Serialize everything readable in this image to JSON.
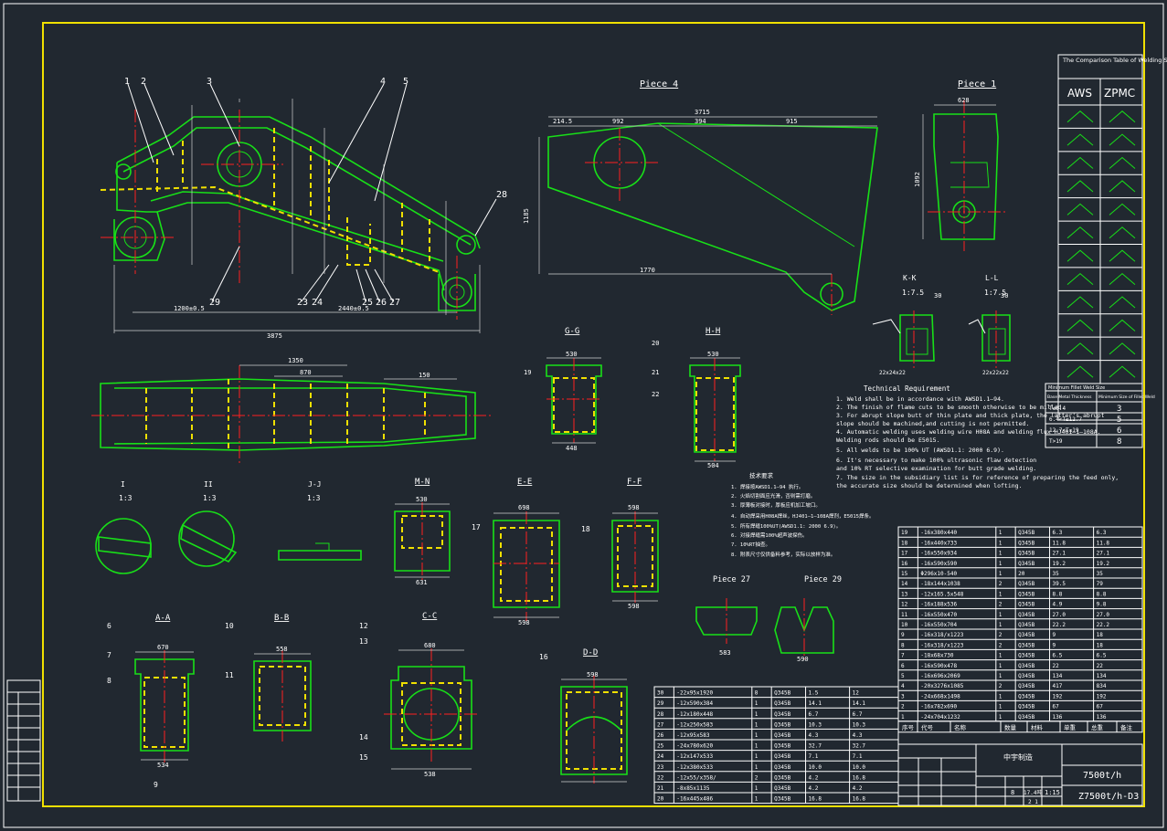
{
  "title_block": {
    "company": "中宇制造",
    "product_title": "7500t/h",
    "drawing_number": "Z7500t/h-D3",
    "scale": "1:15",
    "sheet_numbers": [
      "8",
      "17.4吨"
    ],
    "sheet_of": "2 1"
  },
  "comparison_table": {
    "title": "The Comparison Table of Welding Symbols",
    "col_aws": "AWS",
    "col_zpmc": "ZPMC",
    "min_weld_title": "Minimum Fillet Weld Size",
    "min_weld_header_a": "Base Metal Thickness",
    "min_weld_header_b": "Minimum Size of Fillet Weld",
    "min_weld_rows": [
      {
        "range": "T≤6.4",
        "size": "3"
      },
      {
        "range": "6.4<T≤12.7",
        "size": "5"
      },
      {
        "range": "12.7<T≤19",
        "size": "6"
      },
      {
        "range": "T>19",
        "size": "8"
      }
    ]
  },
  "technical_requirement": {
    "title": "Technical Requirement",
    "lines": [
      "1. Weld shall be in accordance with AWSD1.1—94.",
      "2. The finish of flame cuts to be smooth otherwise to be milled.",
      "3. For abrupt slope butt of thin plate and thick plate, the latter's abrupt",
      "   slope should be machined,and cutting is not permitted.",
      "4. Automatic welding uses welding wire H08A and welding flux HJ401—1—108A.",
      "   Welding rods should be E5015.",
      "5. All welds to be 100% UT (AWSD1.1: 2000 6.9).",
      "6. It's necessary to make 100% ultrasonic flaw detection",
      "   and 10% RT selective examination for butt grade welding.",
      "7. The size in the subsidiary list is for reference of preparing the feed only,",
      "   the accurate size should be determined when lofting."
    ],
    "cn_title": "技术要求",
    "cn_lines": [
      "1. 焊接按AWSD1.1—94 执行。",
      "2. 火焰切割面应光滑，否则需打磨。",
      "3. 厚薄板对接时，厚板应机加工坡口。",
      "4. 自动焊采用H08A焊丝，HJ401—1—108A焊剂，E5015焊条。",
      "5. 所有焊缝100%UT(AWSD1.1: 2000 6.9)。",
      "6. 对接焊缝需100%超声波探伤。",
      "7. 10%RT抽查。",
      "8. 附表尺寸仅供备料参考，实际以放样为准。"
    ]
  },
  "views": {
    "piece4": "Piece 4",
    "piece1": "Piece 1",
    "piece27": "Piece 27",
    "piece29": "Piece 29",
    "kk": "K-K",
    "ll": "L-L",
    "kk_scale": "1:7.5",
    "ll_scale": "1:7.5",
    "gg": "G-G",
    "hh": "H-H",
    "i": "I",
    "ii": "II",
    "jj": "J-J",
    "mn": "M-N",
    "ee": "E-E",
    "ff": "F-F",
    "aa": "A-A",
    "bb": "B-B",
    "cc": "C-C",
    "dd": "D-D",
    "detail_scale": "1:3"
  },
  "dims": {
    "overall": "3875",
    "main_b": "1200±0.5",
    "main_c": "2440±0.5",
    "piece4_len": "3715",
    "piece4_a": "214.5",
    "piece4_b": "992",
    "piece4_c": "394",
    "piece4_d": "915",
    "piece4_e": "1770",
    "piece4_f": "1185",
    "piece1_w": "628",
    "piece1_h": "1092",
    "plan_top": "1350",
    "plan_mid": "870",
    "plan_side": "150",
    "aa_w": "670",
    "aa_b": "534",
    "bb_w": "558",
    "cc_w": "680",
    "cc_b": "538",
    "dd_w": "598",
    "gg_w": "530",
    "gg_b": "448",
    "hh_w": "530",
    "hh_b": "504",
    "mn_w": "530",
    "mn_b": "631",
    "ee_w": "698",
    "ee_b": "598",
    "ff_w": "598",
    "ff_b": "598",
    "p27_w": "583",
    "p29_w": "590",
    "kk_weld": "22x24x22",
    "ll_weld": "22x22x22"
  },
  "callouts": [
    "1",
    "2",
    "3",
    "4",
    "5",
    "6",
    "7",
    "8",
    "9",
    "10",
    "11",
    "12",
    "13",
    "14",
    "15",
    "16",
    "17",
    "18",
    "19",
    "20",
    "21",
    "22",
    "23",
    "24",
    "25",
    "26",
    "27",
    "28",
    "29",
    "30"
  ],
  "parts_list_header": [
    "序号",
    "代号",
    "名称",
    "数量",
    "材料",
    "单重",
    "总重",
    "备注"
  ],
  "parts_list_right": [
    {
      "no": "19",
      "name": "-16x380x440",
      "qty": "1",
      "mat": "Q345B",
      "w1": "6.3",
      "w2": "6.3"
    },
    {
      "no": "18",
      "name": "-16x440x733",
      "qty": "1",
      "mat": "Q345B",
      "w1": "11.8",
      "w2": "11.8"
    },
    {
      "no": "17",
      "name": "-16x550x934",
      "qty": "1",
      "mat": "Q345B",
      "w1": "27.1",
      "w2": "27.1"
    },
    {
      "no": "16",
      "name": "-16x590x590",
      "qty": "1",
      "mat": "Q345B",
      "w1": "19.2",
      "w2": "19.2"
    },
    {
      "no": "15",
      "name": "Φ296x10-540",
      "qty": "1",
      "mat": "20",
      "w1": "35",
      "w2": "35"
    },
    {
      "no": "14",
      "name": "-18x144x1038",
      "qty": "2",
      "mat": "Q345B",
      "w1": "39.5",
      "w2": "79"
    },
    {
      "no": "13",
      "name": "-12x165.5x548",
      "qty": "1",
      "mat": "Q345B",
      "w1": "8.8",
      "w2": "8.8"
    },
    {
      "no": "12",
      "name": "-16x188x536",
      "qty": "2",
      "mat": "Q345B",
      "w1": "4.9",
      "w2": "9.8"
    },
    {
      "no": "11",
      "name": "-16x550x470",
      "qty": "1",
      "mat": "Q345B",
      "w1": "27.0",
      "w2": "27.0"
    },
    {
      "no": "10",
      "name": "-16x550x704",
      "qty": "1",
      "mat": "Q345B",
      "w1": "22.2",
      "w2": "22.2"
    },
    {
      "no": "9",
      "name": "-16x318/x1223",
      "qty": "2",
      "mat": "Q345B",
      "w1": "9",
      "w2": "18"
    },
    {
      "no": "8",
      "name": "-16x318/x1223",
      "qty": "2",
      "mat": "Q345B",
      "w1": "9",
      "w2": "18"
    },
    {
      "no": "7",
      "name": "-18x68x730",
      "qty": "1",
      "mat": "Q345B",
      "w1": "6.5",
      "w2": "6.5"
    },
    {
      "no": "6",
      "name": "-16x590x478",
      "qty": "1",
      "mat": "Q345B",
      "w1": "22",
      "w2": "22"
    },
    {
      "no": "5",
      "name": "-16x696x2069",
      "qty": "1",
      "mat": "Q345B",
      "w1": "134",
      "w2": "134"
    },
    {
      "no": "4",
      "name": "-20x3276x1085",
      "qty": "2",
      "mat": "Q345B",
      "w1": "417",
      "w2": "834"
    },
    {
      "no": "3",
      "name": "-24x668x1498",
      "qty": "1",
      "mat": "Q345B",
      "w1": "192",
      "w2": "192"
    },
    {
      "no": "2",
      "name": "-16x782x690",
      "qty": "1",
      "mat": "Q345B",
      "w1": "67",
      "w2": "67"
    },
    {
      "no": "1",
      "name": "-24x704x1232",
      "qty": "1",
      "mat": "Q345B",
      "w1": "136",
      "w2": "136"
    }
  ],
  "parts_list_left": [
    {
      "no": "30",
      "name": "-22x95x1920",
      "qty": "8",
      "mat": "Q345B",
      "w1": "1.5",
      "w2": "12"
    },
    {
      "no": "29",
      "name": "-12x590x384",
      "qty": "1",
      "mat": "Q345B",
      "w1": "14.1",
      "w2": "14.1"
    },
    {
      "no": "28",
      "name": "-12x180x448",
      "qty": "1",
      "mat": "Q345B",
      "w1": "6.7",
      "w2": "6.7"
    },
    {
      "no": "27",
      "name": "-12x250x583",
      "qty": "1",
      "mat": "Q345B",
      "w1": "10.3",
      "w2": "10.3"
    },
    {
      "no": "26",
      "name": "-12x95x583",
      "qty": "1",
      "mat": "Q345B",
      "w1": "4.3",
      "w2": "4.3"
    },
    {
      "no": "25",
      "name": "-24x780x620",
      "qty": "1",
      "mat": "Q345B",
      "w1": "32.7",
      "w2": "32.7"
    },
    {
      "no": "24",
      "name": "-12x147x533",
      "qty": "1",
      "mat": "Q345B",
      "w1": "7.1",
      "w2": "7.1"
    },
    {
      "no": "23",
      "name": "-12x380x533",
      "qty": "1",
      "mat": "Q345B",
      "w1": "10.0",
      "w2": "10.0"
    },
    {
      "no": "22",
      "name": "-12x55/x358/",
      "qty": "2",
      "mat": "Q345B",
      "w1": "4.2",
      "w2": "16.8"
    },
    {
      "no": "21",
      "name": "-8x85x1135",
      "qty": "1",
      "mat": "Q345B",
      "w1": "4.2",
      "w2": "4.2"
    },
    {
      "no": "20",
      "name": "-16x445x486",
      "qty": "1",
      "mat": "Q345B",
      "w1": "16.8",
      "w2": "16.8"
    }
  ]
}
